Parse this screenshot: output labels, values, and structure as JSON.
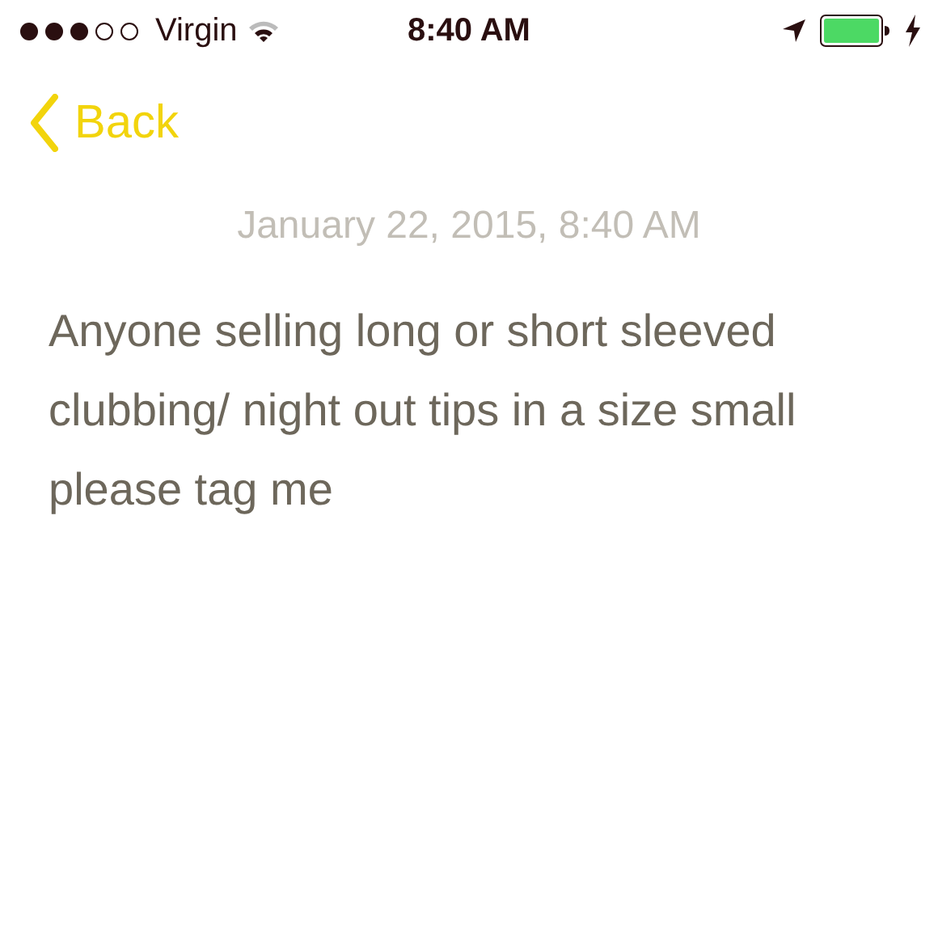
{
  "status_bar": {
    "carrier": "Virgin",
    "time": "8:40 AM"
  },
  "nav": {
    "back": "Back"
  },
  "note": {
    "date": "January 22, 2015, 8:40 AM",
    "body": "Anyone selling long or short sleeved clubbing/ night out tips in a size small please tag me"
  }
}
